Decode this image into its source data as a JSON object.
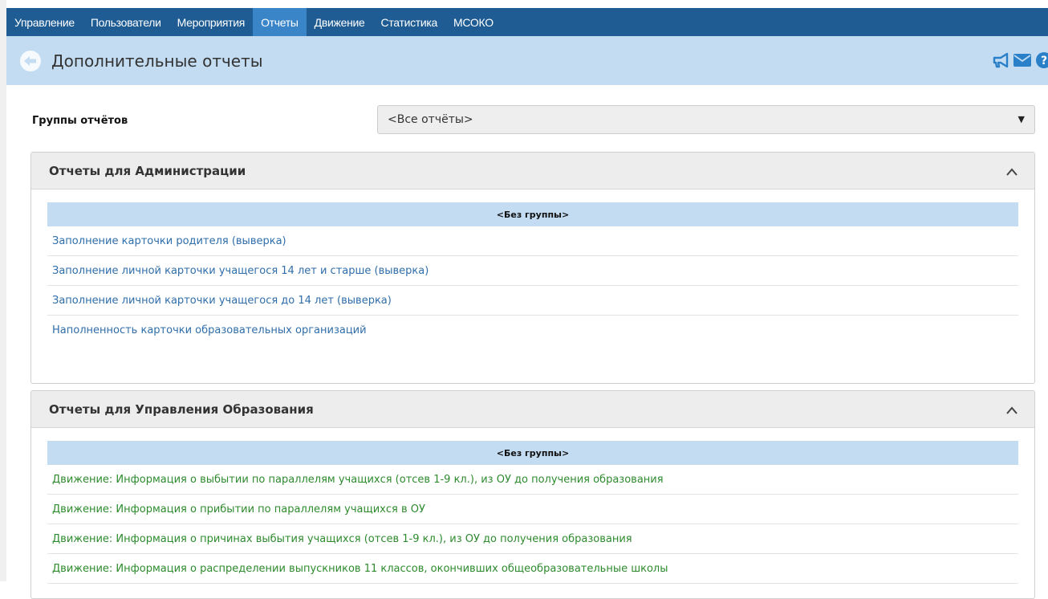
{
  "nav": {
    "items": [
      {
        "label": "Управление"
      },
      {
        "label": "Пользователи"
      },
      {
        "label": "Мероприятия"
      },
      {
        "label": "Отчеты"
      },
      {
        "label": "Движение"
      },
      {
        "label": "Статистика"
      },
      {
        "label": "МСОКО"
      }
    ],
    "active": "Отчеты"
  },
  "header": {
    "title": "Дополнительные отчеты",
    "icons": [
      "back-icon",
      "megaphone-icon",
      "mail-icon",
      "help-icon"
    ]
  },
  "filter": {
    "label": "Группы отчётов",
    "selected": "<Все отчёты>"
  },
  "panels": [
    {
      "title": "Отчеты для Администрации",
      "group": "<Без группы>",
      "reports": [
        "Заполнение карточки родителя (выверка)",
        "Заполнение личной карточки учащегося 14 лет и старше (выверка)",
        "Заполнение личной карточки учащегося до 14 лет (выверка)",
        "Наполненность карточки образовательных организаций"
      ]
    },
    {
      "title": "Отчеты для Управления Образования",
      "group": "<Без группы>",
      "reports": [
        "Движение: Информация о выбытии по параллелям учащихся (отсев 1-9 кл.), из ОУ до получения образования",
        "Движение: Информация о прибытии по параллелям учащихся в ОУ",
        "Движение: Информация о причинах выбытия учащихся (отсев 1-9 кл.), из ОУ до получения образования",
        "Движение: Информация о распределении выпускников 11 классов, окончивших общеобразовательные школы"
      ]
    }
  ],
  "colors": {
    "nav_bg": "#1e5c93",
    "nav_active": "#3a85c8",
    "title_bg": "#c3dcf2",
    "link_blue": "#2f6eaa",
    "link_green": "#2e8b2e",
    "icon_blue": "#2a7fc9"
  }
}
